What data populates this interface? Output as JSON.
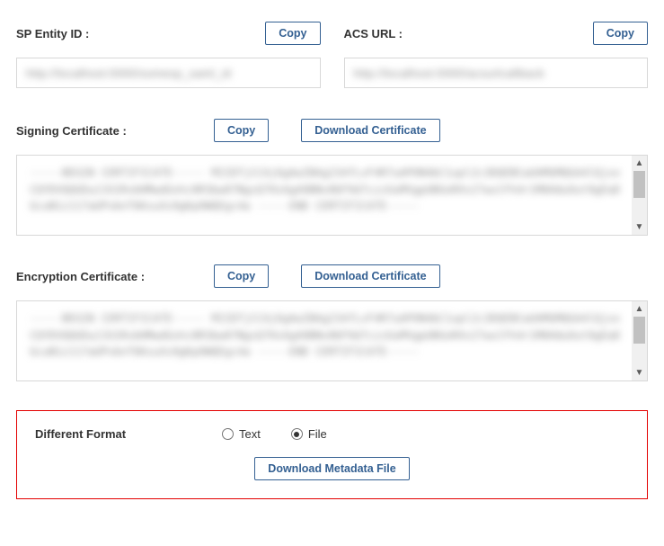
{
  "sp_entity": {
    "label": "SP Entity ID :",
    "copy": "Copy",
    "value": "http://localhost:0000/somesp_saml_id"
  },
  "acs_url": {
    "label": "ACS URL :",
    "copy": "Copy",
    "value": "http://localhost:0000/acsurlcallback"
  },
  "signing_cert": {
    "label": "Signing Certificate :",
    "copy": "Copy",
    "download": "Download Certificate",
    "value": "-----BEGIN CERTIFICATE-----\nMIIDTjCCAj6gAwIBAg234fLvF4R7uAPON4bC1upl2c3DQEBCwUAMGMQGA4lQjxxCQYDVQQGEwJJU1RvbHMwdGxhc0R3bw07NgsQ7HzAgA9BNv86F9d7czzUuMVgpUBGoRXv27wulFh4r1M6HduOut9gEaDGcuN1z117aUPvbnT6KsuXs9gKpOWQEgc4a\n-----END CERTIFICATE-----"
  },
  "encryption_cert": {
    "label": "Encryption Certificate :",
    "copy": "Copy",
    "download": "Download Certificate",
    "value": "-----BEGIN CERTIFICATE-----\nMIIDTjCCAj6gAwIBAg234fLvF4R7uAPON4bC1upl2c3DQEBCwUAMGMQGA4lQjxxCQYDVQQGEwJJU1RvbHMwdGxhc0R3bw07NgsQ7HzAgA9BNv86F9d7czzUuMVgpUBGoRXv27wulFh4r1M6HduOut9gEaDGcuN1z117aUPvbnT6KsuXs9gKpOWQEgc4a\n-----END CERTIFICATE-----"
  },
  "format": {
    "label": "Different Format",
    "options": {
      "text": "Text",
      "file": "File"
    },
    "selected": "file",
    "download": "Download Metadata File"
  }
}
